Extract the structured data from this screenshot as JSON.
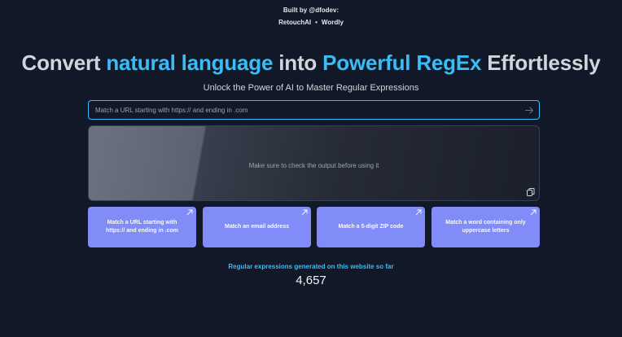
{
  "header": {
    "built_by": "Built by @dfodev:",
    "links": [
      {
        "label": "RetouchAI"
      },
      {
        "label": "Wordly"
      }
    ],
    "separator": "•"
  },
  "hero": {
    "part1": "Convert ",
    "part2": "natural language",
    "part3": " into ",
    "part4": "Powerful RegEx",
    "part5": " Effortlessly",
    "subtitle": "Unlock the Power of AI to Master Regular Expressions"
  },
  "prompt": {
    "placeholder": "Match a URL starting with https:// and ending in .com",
    "value": ""
  },
  "output": {
    "placeholder": "Make sure to check the output before using it"
  },
  "examples": [
    {
      "label": "Match a URL starting with https:// and ending in .com"
    },
    {
      "label": "Match an email address"
    },
    {
      "label": "Match a 5-digit ZIP code"
    },
    {
      "label": "Match a word containing only uppercase letters"
    }
  ],
  "stats": {
    "label": "Regular expressions generated on this website so far",
    "count": "4,657"
  },
  "colors": {
    "background": "#111827",
    "accent": "#38bdf8",
    "card": "#818cf8"
  }
}
